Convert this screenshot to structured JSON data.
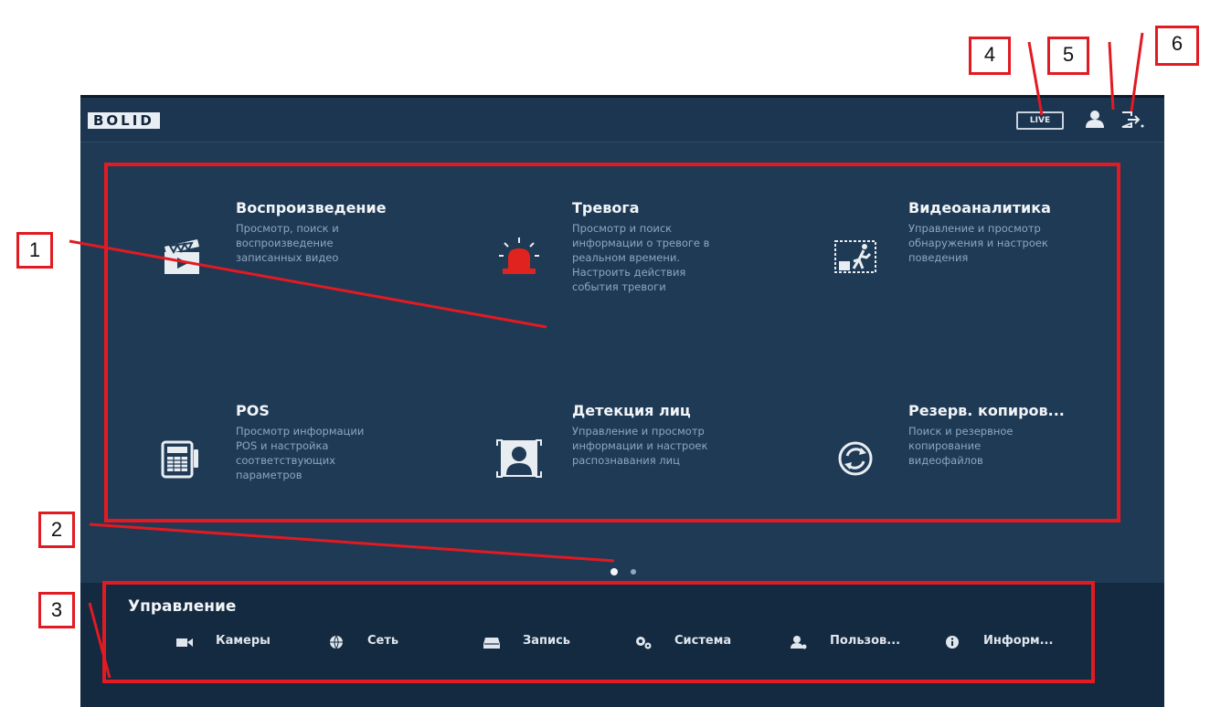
{
  "header": {
    "logo_text": "BOLID",
    "live_label": "LIVE",
    "user_icon": "user-icon",
    "logout_icon": "logout-icon"
  },
  "features": [
    {
      "title": "Воспроизведение",
      "description": "Просмотр, поиск и\nвоспроизведение\nзаписанных видео",
      "icon": "clapperboard-icon"
    },
    {
      "title": "Тревога",
      "description": "Просмотр и поиск\nинформации о тревоге в\nреальном времени.\nНастроить действия\nсобытия тревоги",
      "icon": "alarm-siren-icon"
    },
    {
      "title": "Видеоаналитика",
      "description": "Управление и просмотр\nобнаружения и настроек\nповедения",
      "icon": "video-analytics-icon"
    },
    {
      "title": "POS",
      "description": "Просмотр информации\nPOS и настройка\nсоответствующих\nпараметров",
      "icon": "pos-terminal-icon"
    },
    {
      "title": "Детекция лиц",
      "description": "Управление и просмотр\nинформации и настроек\nраспознавания лиц",
      "icon": "face-detection-icon"
    },
    {
      "title": "Резерв. копиров...",
      "description": "Поиск и резервное\nкопирование\nвидеофайлов",
      "icon": "backup-icon"
    }
  ],
  "pager": {
    "pages": 2,
    "active": 1
  },
  "management": {
    "title": "Управление",
    "items": [
      {
        "label": "Камеры",
        "icon": "camera-icon"
      },
      {
        "label": "Сеть",
        "icon": "network-icon"
      },
      {
        "label": "Запись",
        "icon": "storage-icon"
      },
      {
        "label": "Система",
        "icon": "gears-icon"
      },
      {
        "label": "Пользов...",
        "icon": "users-icon"
      },
      {
        "label": "Информ...",
        "icon": "info-icon"
      }
    ]
  },
  "annotations": {
    "labels": [
      "1",
      "2",
      "3",
      "4",
      "5",
      "6"
    ],
    "color": "#e21a22"
  },
  "colors": {
    "panel": "#1f3a55",
    "bottom_bar": "#142a40",
    "alarm_red": "#e0231f"
  }
}
